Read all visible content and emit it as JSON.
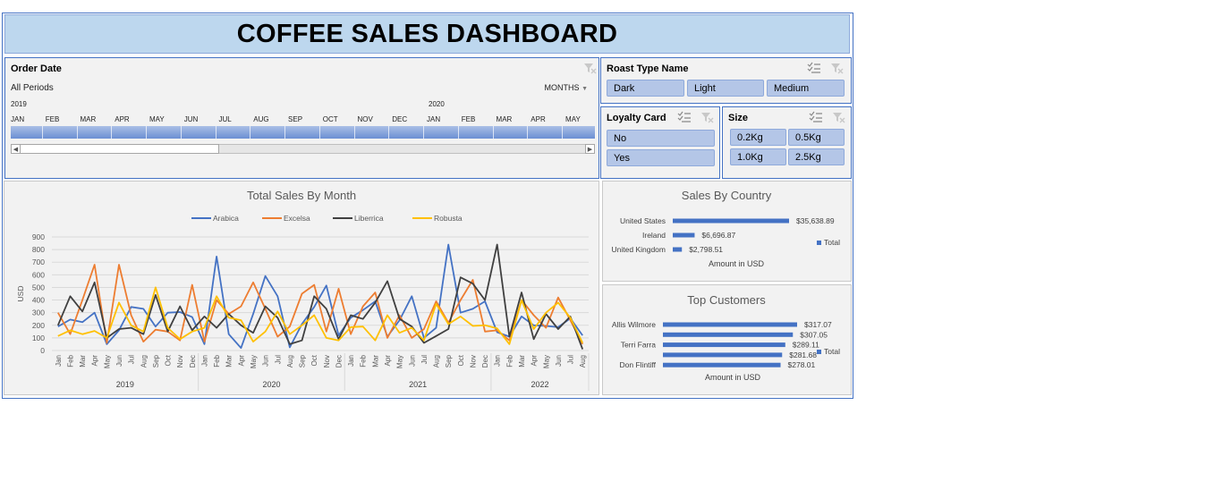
{
  "dashboard": {
    "title": "COFFEE SALES DASHBOARD"
  },
  "timeline": {
    "header": "Order Date",
    "periods": "All Periods",
    "level": "MONTHS",
    "years": [
      "2019",
      "2020"
    ],
    "months": [
      "JAN",
      "FEB",
      "MAR",
      "APR",
      "MAY",
      "JUN",
      "JUL",
      "AUG",
      "SEP",
      "OCT",
      "NOV",
      "DEC",
      "JAN",
      "FEB",
      "MAR",
      "APR",
      "MAY"
    ]
  },
  "roast_slicer": {
    "header": "Roast Type Name",
    "items": [
      "Dark",
      "Light",
      "Medium"
    ]
  },
  "loyalty_slicer": {
    "header": "Loyalty Card",
    "items": [
      "No",
      "Yes"
    ]
  },
  "size_slicer": {
    "header": "Size",
    "items": [
      "0.2Kg",
      "0.5Kg",
      "1.0Kg",
      "2.5Kg"
    ]
  },
  "colors": {
    "arabica": "#4472c4",
    "excelsa": "#ed7d31",
    "liberica": "#404040",
    "robusta": "#ffc000",
    "bar": "#4472c4"
  },
  "chart_data": [
    {
      "type": "line",
      "title": "Total Sales By Month",
      "ylabel": "USD",
      "ylim": [
        0,
        900
      ],
      "yticks": [
        0,
        100,
        200,
        300,
        400,
        500,
        600,
        700,
        800,
        900
      ],
      "grid": true,
      "legend": "top",
      "years": [
        {
          "label": "2019",
          "count": 12
        },
        {
          "label": "2020",
          "count": 12
        },
        {
          "label": "2021",
          "count": 12
        },
        {
          "label": "2022",
          "count": 8
        }
      ],
      "categories": [
        "Jan",
        "Feb",
        "Mar",
        "Apr",
        "May",
        "Jun",
        "Jul",
        "Aug",
        "Sep",
        "Oct",
        "Nov",
        "Dec",
        "Jan",
        "Feb",
        "Mar",
        "Apr",
        "May",
        "Jun",
        "Jul",
        "Aug",
        "Sep",
        "Oct",
        "Nov",
        "Dec",
        "Jan",
        "Feb",
        "Mar",
        "Apr",
        "May",
        "Jun",
        "Jul",
        "Aug",
        "Sep",
        "Oct",
        "Nov",
        "Dec",
        "Jan",
        "Feb",
        "Mar",
        "Apr",
        "May",
        "Jun",
        "Jul",
        "Aug"
      ],
      "series": [
        {
          "name": "Arabica",
          "color": "#4472c4",
          "values": [
            190,
            245,
            225,
            300,
            50,
            160,
            345,
            330,
            190,
            300,
            305,
            265,
            50,
            745,
            130,
            20,
            290,
            590,
            430,
            25,
            210,
            345,
            515,
            120,
            260,
            320,
            390,
            110,
            240,
            430,
            100,
            180,
            840,
            300,
            330,
            390,
            145,
            110,
            270,
            200,
            195,
            185,
            255,
            120
          ]
        },
        {
          "name": "Excelsa",
          "color": "#ed7d31",
          "values": [
            300,
            130,
            400,
            680,
            60,
            680,
            280,
            70,
            165,
            150,
            80,
            520,
            70,
            400,
            290,
            350,
            540,
            330,
            110,
            190,
            450,
            520,
            150,
            490,
            130,
            350,
            460,
            100,
            280,
            100,
            170,
            390,
            220,
            400,
            560,
            150,
            160,
            80,
            400,
            280,
            180,
            420,
            240,
            50
          ]
        },
        {
          "name": "Liberrica",
          "color": "#404040",
          "values": [
            200,
            430,
            310,
            540,
            100,
            170,
            180,
            130,
            440,
            150,
            350,
            160,
            270,
            180,
            290,
            200,
            140,
            350,
            260,
            50,
            80,
            430,
            330,
            90,
            280,
            250,
            380,
            550,
            250,
            190,
            60,
            115,
            170,
            580,
            530,
            400,
            840,
            110,
            460,
            90,
            290,
            170,
            270,
            10
          ]
        },
        {
          "name": "Robusta",
          "color": "#ffc000",
          "values": [
            115,
            160,
            130,
            155,
            100,
            380,
            200,
            150,
            500,
            180,
            90,
            150,
            180,
            430,
            260,
            240,
            70,
            150,
            310,
            130,
            200,
            280,
            100,
            80,
            185,
            190,
            80,
            280,
            140,
            180,
            80,
            370,
            210,
            270,
            195,
            200,
            175,
            50,
            400,
            170,
            300,
            380,
            260,
            60
          ]
        }
      ]
    },
    {
      "type": "bar",
      "title": "Sales By Country",
      "xlabel": "Amount in USD",
      "legend": "right",
      "series": [
        {
          "name": "Total",
          "values": [
            35638.89,
            6696.87,
            2798.51
          ]
        }
      ],
      "categories": [
        "United States",
        "Ireland",
        "United Kingdom"
      ],
      "value_labels": [
        "$35,638.89",
        "$6,696.87",
        "$2,798.51"
      ]
    },
    {
      "type": "bar",
      "title": "Top Customers",
      "xlabel": "Amount in USD",
      "legend": "right",
      "series": [
        {
          "name": "Total",
          "values": [
            317.07,
            307.05,
            289.11,
            281.68,
            278.01
          ]
        }
      ],
      "categories": [
        "Allis Wilmore",
        "",
        "Terri Farra",
        "",
        "Don Flintiff"
      ],
      "value_labels": [
        "$317.07",
        "$307.05",
        "$289.11",
        "$281.68",
        "$278.01"
      ]
    }
  ]
}
